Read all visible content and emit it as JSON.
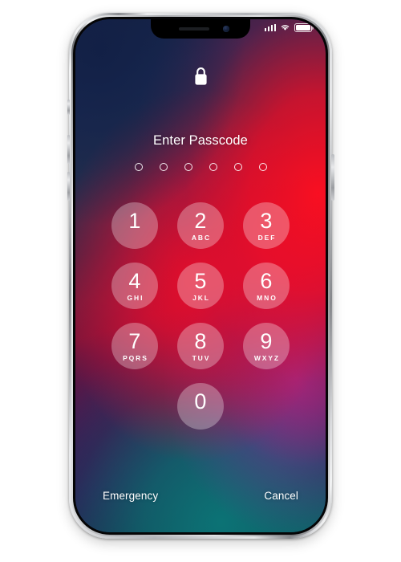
{
  "device": {
    "name": "iphone-x",
    "frame_color": "#b4b6ba",
    "bezel_color": "#0a0a0c"
  },
  "status_bar": {
    "signal_icon": "cellular-signal-icon",
    "signal_bars": 4,
    "wifi_icon": "wifi-icon",
    "battery_icon": "battery-icon",
    "battery_level": 88
  },
  "notch": {
    "speaker_icon": "speaker-grille-icon",
    "camera_icon": "front-camera-icon"
  },
  "lock_screen": {
    "lock_icon": "lock-closed-icon",
    "prompt": "Enter Passcode",
    "passcode_length": 6,
    "entered_count": 0
  },
  "keypad": {
    "rows": [
      [
        {
          "digit": "1",
          "letters": ""
        },
        {
          "digit": "2",
          "letters": "ABC"
        },
        {
          "digit": "3",
          "letters": "DEF"
        }
      ],
      [
        {
          "digit": "4",
          "letters": "GHI"
        },
        {
          "digit": "5",
          "letters": "JKL"
        },
        {
          "digit": "6",
          "letters": "MNO"
        }
      ],
      [
        {
          "digit": "7",
          "letters": "PQRS"
        },
        {
          "digit": "8",
          "letters": "TUV"
        },
        {
          "digit": "9",
          "letters": "WXYZ"
        }
      ],
      [
        {
          "digit": "0",
          "letters": ""
        }
      ]
    ]
  },
  "bottom_actions": {
    "emergency_label": "Emergency",
    "cancel_label": "Cancel"
  },
  "wallpaper": {
    "description": "abstract gradient",
    "colors": [
      "#16203f",
      "#1b2c56",
      "#ff0e20",
      "#b02ea0",
      "#0c7476"
    ]
  },
  "side_buttons": {
    "mute_switch": "mute-switch",
    "volume_up": "volume-up-button",
    "volume_down": "volume-down-button",
    "power": "power-button"
  }
}
